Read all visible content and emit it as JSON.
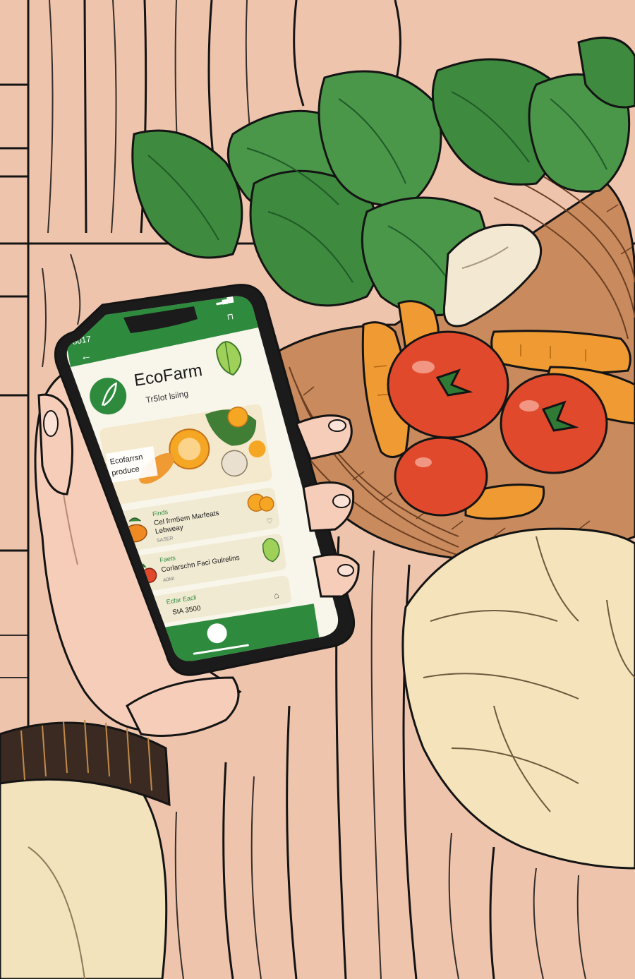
{
  "colors": {
    "table": "#efc4ad",
    "table_lines": "#141414",
    "leaf": "#3e8a3e",
    "leaf_light": "#6aaa52",
    "tomato": "#e0492c",
    "carrot": "#ef9a32",
    "basket": "#c98a5d",
    "cloth": "#f4e3bb",
    "skin": "#f6cdb8",
    "sleeve": "#f3e3bd",
    "cuff": "#3b2a22",
    "phone_body": "#1b1b1b",
    "app_green": "#2e8b3e",
    "screen_bg": "#f8f5ea"
  },
  "status_bar": {
    "time": "8017"
  },
  "app": {
    "title": "EcoFarm",
    "subtitle": "Tr5lot lsiing",
    "logo_icon": "leaf-icon",
    "banner_label_line1": "Ecofarrsn",
    "banner_label_line2": "produce",
    "items": [
      {
        "category": "Finds",
        "name_line1": "Cel frm5em Marfeats",
        "name_line2": "Lebweay",
        "meta": "SASER",
        "icon": "pumpkin-icon"
      },
      {
        "category": "Faets",
        "name_line1": "Corlarschn Faci Gulrelins",
        "name_line2": "",
        "meta": "A0MI",
        "icon": "tomato-icon"
      },
      {
        "category": "Ecfar Eacli",
        "name_line1": "StA 3500",
        "name_line2": "",
        "meta": "",
        "icon": "tomato-icon"
      }
    ]
  }
}
